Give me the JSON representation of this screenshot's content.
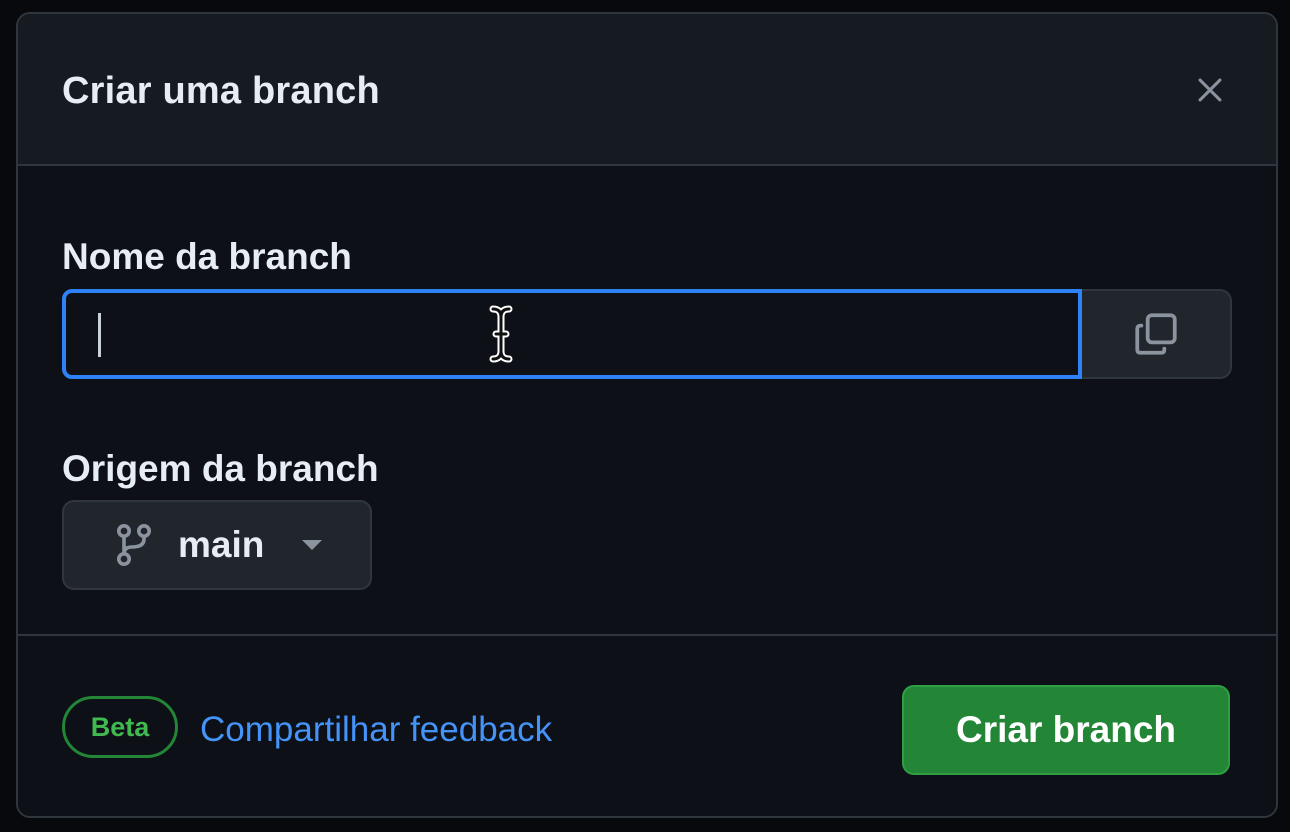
{
  "dialog": {
    "title": "Criar uma branch"
  },
  "form": {
    "name_label": "Nome da branch",
    "name_value": "",
    "origin_label": "Origem da branch",
    "origin_branch": "main"
  },
  "footer": {
    "badge": "Beta",
    "feedback_link": "Compartilhar feedback",
    "submit_label": "Criar branch"
  },
  "colors": {
    "accent": "#2f81f7",
    "primary_button": "#238636",
    "badge": "#3fb950",
    "link": "#4493f8"
  },
  "icons": {
    "close": "close-icon",
    "copy": "copy-icon",
    "branch": "git-branch-icon",
    "dropdown": "triangle-down-icon"
  }
}
